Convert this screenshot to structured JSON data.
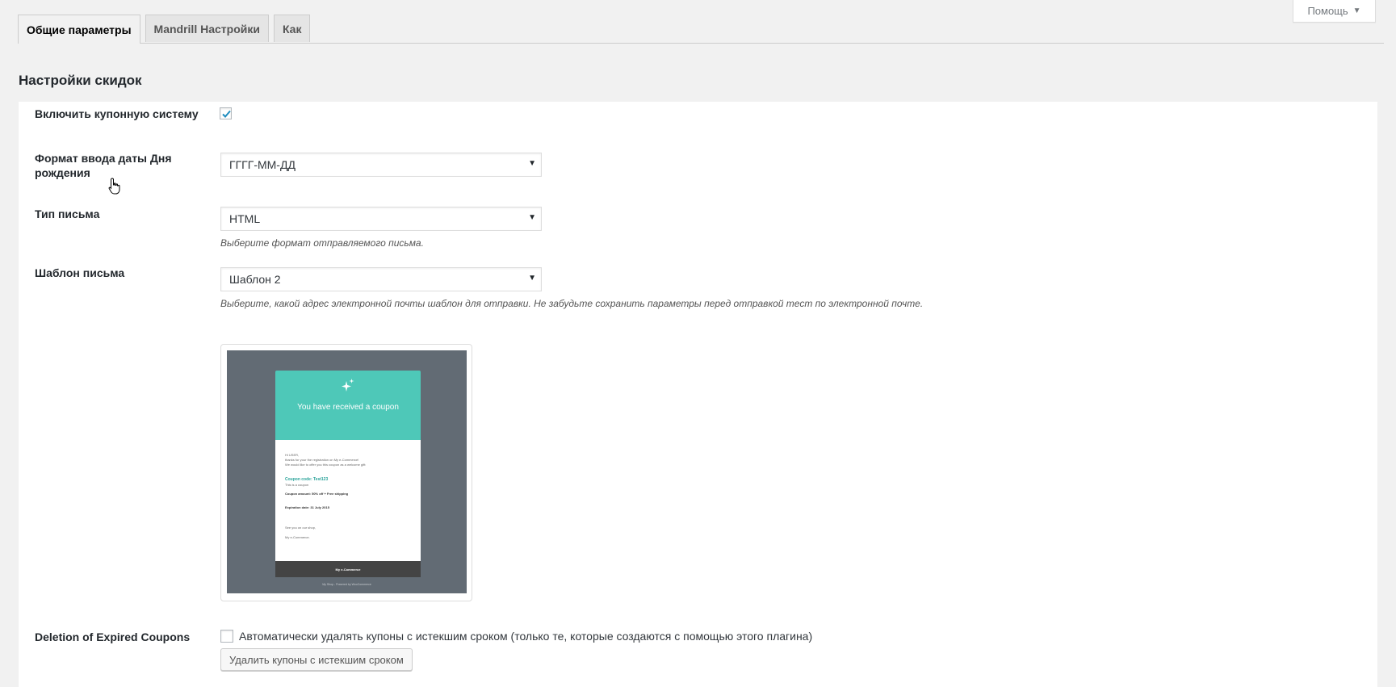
{
  "help": {
    "label": "Помощь",
    "arrow": "▼"
  },
  "tabs": [
    {
      "label": "Общие параметры",
      "active": true
    },
    {
      "label": "Mandrill Настройки",
      "active": false
    },
    {
      "label": "Как",
      "active": false
    }
  ],
  "page_title": "Настройки скидок",
  "settings": {
    "coupon_system": {
      "label": "Включить купонную систему",
      "checked": true
    },
    "birthday_format": {
      "label": "Формат ввода даты Дня рождения",
      "value": "ГГГГ-ММ-ДД"
    },
    "email_type": {
      "label": "Тип письма",
      "value": "HTML",
      "description": "Выберите формат отправляемого письма."
    },
    "email_template": {
      "label": "Шаблон письма",
      "value": "Шаблон 2",
      "description": "Выберите, какой адрес электронной почты шаблон для отправки. Не забудьте сохранить параметры перед отправкой тест по электронной почте."
    },
    "deletion": {
      "label": "Deletion of Expired Coupons",
      "checkbox_label": "Автоматически удалять купоны с истекшим сроком (только те, которые создаются с помощью этого плагина)",
      "checked": false,
      "button_label": "Удалить купоны с истекшим сроком"
    }
  },
  "preview": {
    "header": "You have received a coupon",
    "greeting": "Hi USER,",
    "line1": "thanks for your the registration on My e-Commerce!",
    "line2": "We would like to offer you this coupon as a welcome gift:",
    "coupon_code": "Coupon code: Test123",
    "coupon_desc": "This is a coupon",
    "amount": "Coupon amount: 50% off + Free shipping",
    "expiration": "Expiration date: 31 July 2015",
    "see_you": "See you on our shop,",
    "sign": "My e-Commerce.",
    "footer": "My e-Commerce",
    "powered": "My Shop - Powered by WooCommerce"
  },
  "colors": {
    "accent": "#0073aa",
    "template_header": "#4ec8b8",
    "template_bg": "#626b74"
  }
}
